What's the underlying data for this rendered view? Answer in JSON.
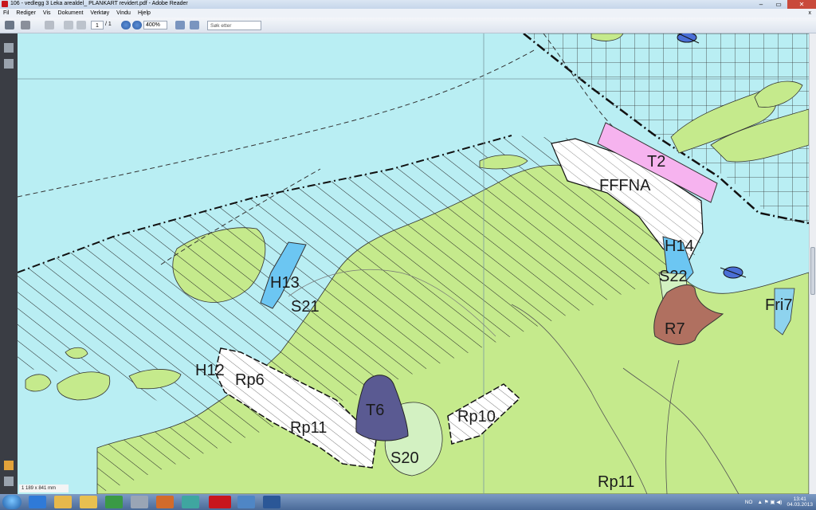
{
  "window": {
    "title": "106 - vedlegg 3 Leka arealdel_ PLANKART revidert.pdf - Adobe Reader"
  },
  "window_controls": {
    "minimize": "–",
    "maximize": "▭",
    "close": "✕"
  },
  "menu": {
    "items": [
      "Fil",
      "Rediger",
      "Vis",
      "Dokument",
      "Verktøy",
      "Vindu",
      "Hjelp"
    ],
    "close_x": "x"
  },
  "toolbar": {
    "page_current": "1",
    "page_total": "/ 1",
    "zoom": "400%",
    "search_placeholder": "Søk etter"
  },
  "map": {
    "labels": [
      "T2",
      "FFFNA",
      "H14",
      "S22",
      "H13",
      "S21",
      "Fri7",
      "R7",
      "H12",
      "Rp6",
      "T6",
      "Rp10",
      "Rp11",
      "S20",
      "Rp11"
    ],
    "colors": {
      "sea": "#b9eef3",
      "land": "#c5ea8c",
      "pink_zone": "#f6b3ef",
      "blue_zone": "#6cc6f2",
      "purple_zone": "#5a5a92",
      "brown_zone": "#b07060"
    }
  },
  "status": {
    "doc_size": "1 189 x 841 mm"
  },
  "taskbar": {
    "language": "NO",
    "time": "13:41",
    "date": "04.03.2013"
  }
}
